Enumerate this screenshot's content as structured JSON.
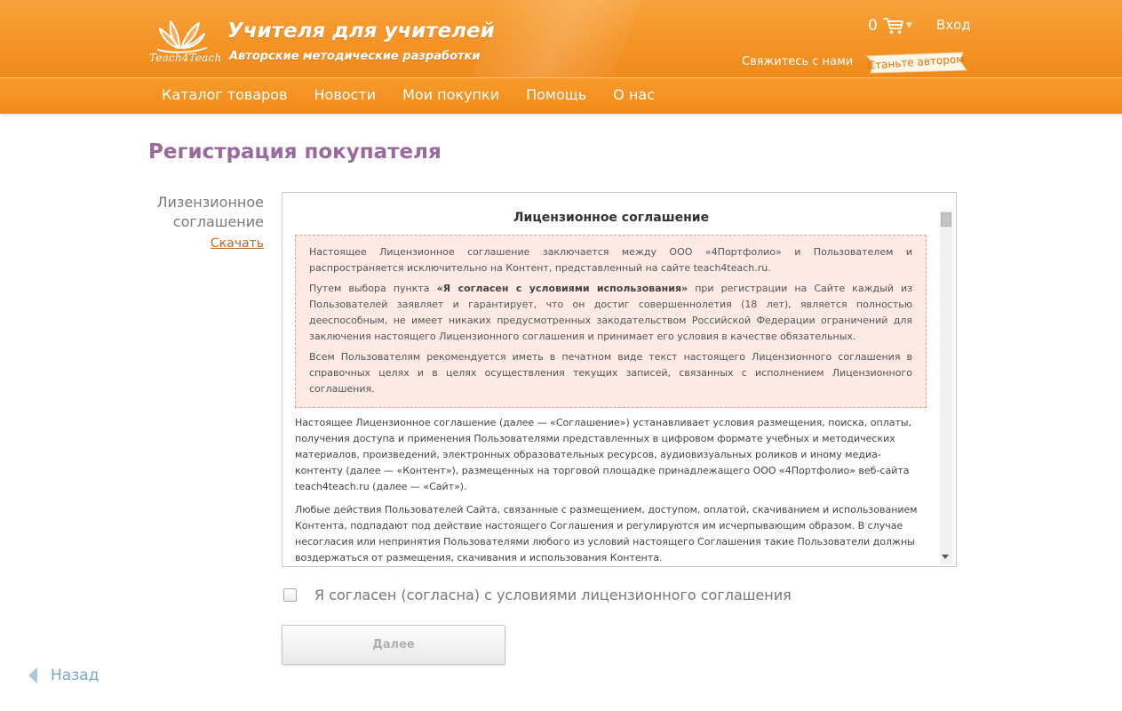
{
  "header": {
    "logo_text": "Teach4Teach",
    "title": "Учителя для учителей",
    "subtitle": "Авторские методические разработки",
    "cart_count": "0",
    "login_label": "Вход",
    "contact_label": "Свяжитесь с нами",
    "become_author_label": "Станьте автором"
  },
  "nav": {
    "items": [
      {
        "label": "Каталог товаров"
      },
      {
        "label": "Новости"
      },
      {
        "label": "Мои покупки"
      },
      {
        "label": "Помощь"
      },
      {
        "label": "О нас"
      }
    ]
  },
  "page": {
    "title": "Регистрация покупателя",
    "side_label": "Лизензионное соглашение",
    "download_label": "Скачать"
  },
  "agreement": {
    "title": "Лицензионное соглашение",
    "notice": {
      "p1": "Настоящее Лицензионное соглашение заключается между ООО «4Портфолио» и Пользователем и распространяется исключительно на Контент, представленный на сайте teach4teach.ru.",
      "p2_before": "Путем выбора пункта ",
      "p2_bold": "«Я согласен с условиями использования»",
      "p2_after": " при регистрации на Сайте каждый из Пользователей заявляет и гарантирует, что он достиг совершеннолетия (18 лет), является полностью дееспособным, не имеет никаких предусмотренных закодательством Российской Федерации ограничений для заключения настоящего Лицензионного соглашения и принимает его условия в качестве обязательных.",
      "p3": "Всем Пользователям рекомендуется иметь в печатном виде текст настоящего Лицензионного соглашения в справочных целях и в целях осуществления текущих записей, связанных с исполнением Лицензионного соглашения."
    },
    "body": {
      "p1": "Настоящее Лицензионное соглашение (далее — «Соглашение») устанавливает условия размещения, поиска, оплаты, получения доступа и применения Пользователями представленных в цифровом формате учебных и методических материалов, произведений, электронных образовательных ресурсов, аудиовизуальных роликов и иному медиа-контенту (далее — «Контент»), размещенных на торговой площадке принадлежащего ООО «4Портфолио» веб-сайта teach4teach.ru (далее — «Сайт»).",
      "p2": "Любые действия Пользователей Сайта, связанные с размещением, доступом, оплатой, скачиванием и использованием Контента, подпадают под действие настоящего Соглашения и регулируются им исчерпывающим образом. В случае несогласия или непринятия Пользователями любого из условий настоящего Соглашения такие Пользователи должны воздержаться от размещения, скачивания и использования Контента."
    }
  },
  "form": {
    "agree_label": "Я согласен (согласна) с условиями лицензионного соглашения",
    "agree_checked": false,
    "next_label": "Далее"
  },
  "footer": {
    "back_label": "Назад"
  },
  "colors": {
    "header_orange": "#f49427",
    "title_purple": "#9a6a9e",
    "link_orange": "#c46a22",
    "notice_bg": "#fdeae4",
    "back_blue": "#7aa5cf"
  }
}
